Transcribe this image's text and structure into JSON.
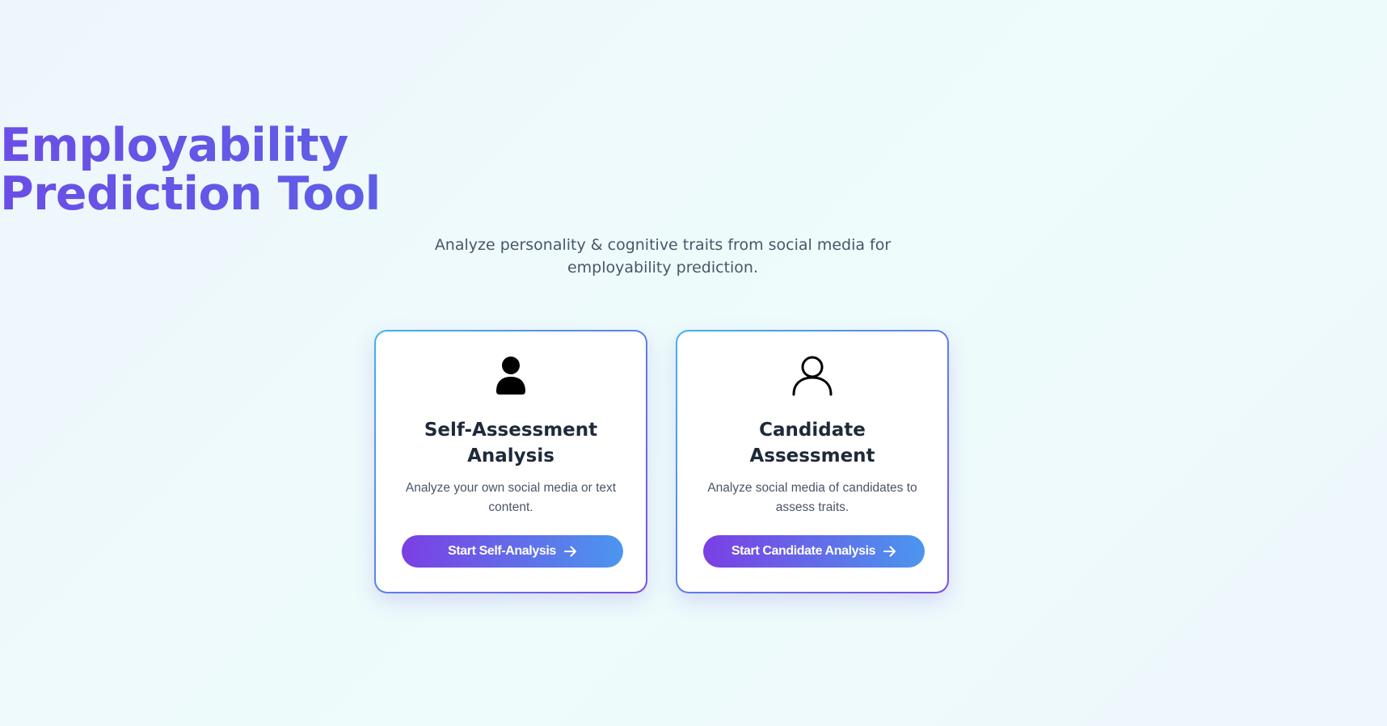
{
  "hero": {
    "title_line1": "Employability",
    "title_line2": "Prediction Tool",
    "subtitle": "Analyze personality & cognitive traits from social media for employability prediction."
  },
  "cards": [
    {
      "icon": "user-filled-icon",
      "title": "Self-Assessment Analysis",
      "description": "Analyze your own social media or text content.",
      "button_label": "Start Self-Analysis"
    },
    {
      "icon": "user-outline-icon",
      "title": "Candidate Assessment",
      "description": "Analyze social media of candidates to assess traits.",
      "button_label": "Start Candidate Analysis"
    }
  ],
  "colors": {
    "title_gradient_start": "#6b4ee6",
    "title_gradient_end": "#3f87e6",
    "button_gradient_start": "#7b3fe4",
    "button_gradient_end": "#4b96ee",
    "card_border_start": "#3fb5ea",
    "card_border_end": "#7b4de6"
  }
}
